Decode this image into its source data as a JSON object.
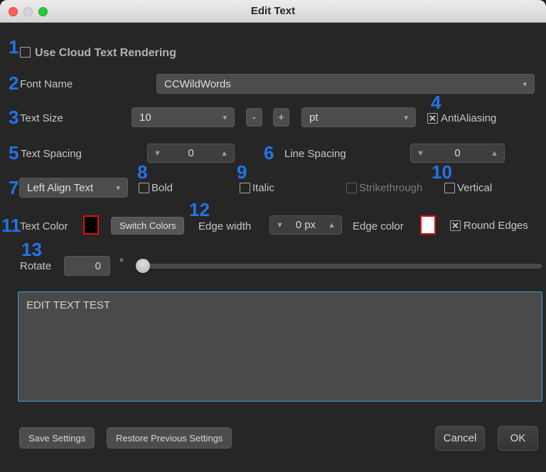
{
  "window": {
    "title": "Edit Text"
  },
  "annotations": [
    "1",
    "2",
    "3",
    "4",
    "5",
    "6",
    "7",
    "8",
    "9",
    "10",
    "11",
    "12",
    "13"
  ],
  "cloud": {
    "label": "Use Cloud Text Rendering"
  },
  "font_name": {
    "label": "Font Name",
    "value": "CCWildWords"
  },
  "text_size": {
    "label": "Text Size",
    "value": "10",
    "minus": "-",
    "plus": "+",
    "unit_value": "pt",
    "antialiasing_label": "AntiAliasing"
  },
  "text_spacing": {
    "label": "Text Spacing",
    "value": "0"
  },
  "line_spacing": {
    "label": "Line Spacing",
    "value": "0"
  },
  "alignment": {
    "value": "Left Align Text"
  },
  "styles": {
    "bold": "Bold",
    "italic": "Italic",
    "strikethrough": "Strikethrough",
    "vertical": "Vertical"
  },
  "color_row": {
    "text_color_label": "Text Color",
    "text_color_value": "#000000",
    "switch_colors_label": "Switch Colors",
    "edge_width_label": "Edge width",
    "edge_width_value": "0 px",
    "edge_color_label": "Edge color",
    "edge_color_value": "#ffffff",
    "round_edges_label": "Round Edges"
  },
  "rotate": {
    "label": "Rotate",
    "value": "0",
    "unit": "°"
  },
  "text_content": {
    "value": "EDIT TEXT TEST"
  },
  "footer": {
    "save": "Save Settings",
    "restore": "Restore Previous Settings",
    "cancel": "Cancel",
    "ok": "OK"
  },
  "colors": {
    "annotation_blue": "#2274e8",
    "focus_border": "#3d9bd9",
    "swatch_border": "#e01010"
  }
}
